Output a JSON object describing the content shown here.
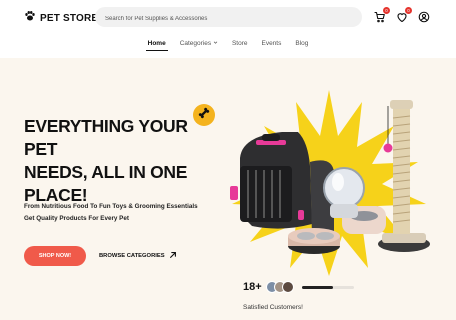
{
  "header": {
    "logo_text": "PET STORE",
    "search_placeholder": "Search for Pet Supplies & Accessories",
    "cart_count": "0",
    "wishlist_count": "0"
  },
  "nav": {
    "items": [
      {
        "label": "Home"
      },
      {
        "label": "Categories"
      },
      {
        "label": "Store"
      },
      {
        "label": "Events"
      },
      {
        "label": "Blog"
      }
    ]
  },
  "hero": {
    "headline_1": "EVERYTHING YOUR PET",
    "headline_2": "NEEDS, ALL IN ONE",
    "headline_3": "PLACE!",
    "sub_1": "From Nutritious Food To Fun Toys & Grooming Essentials",
    "sub_2": "Get Quality Products For Every Pet",
    "shop_label": "SHOP NOW!",
    "browse_label": "BROWSE CATEGORIES",
    "customer_count": "18+",
    "satisfied_label": "Satisfied Customers!",
    "rating_progress": 0.6
  },
  "colors": {
    "accent": "#f05a4a",
    "hero_bg": "#fbf6ee",
    "burst": "#f6d21a",
    "badge": "#e5342d",
    "pink": "#e73a98"
  }
}
